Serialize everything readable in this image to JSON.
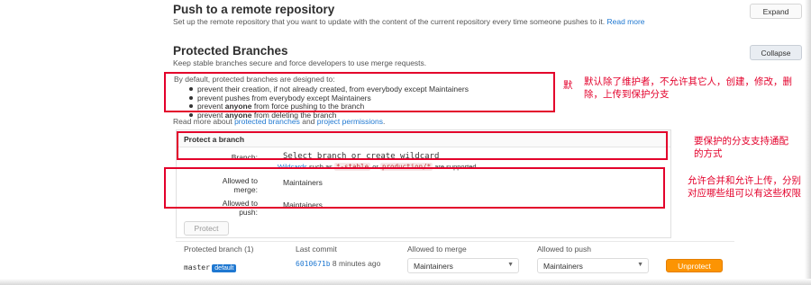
{
  "push_section": {
    "title": "Push to a remote repository",
    "description": "Set up the remote repository that you want to update with the content of the current repository every time someone pushes to it.",
    "read_more": "Read more",
    "expand_label": "Expand"
  },
  "protected_section": {
    "title": "Protected Branches",
    "description": "Keep stable branches secure and force developers to use merge requests.",
    "collapse_label": "Collapse",
    "defaults_heading": "By default, protected branches are designed to:",
    "bullets": [
      {
        "pre": "prevent their creation, if not already created, from everybody except Maintainers",
        "bold": "",
        "post": ""
      },
      {
        "pre": "prevent pushes from everybody except Maintainers",
        "bold": "",
        "post": ""
      },
      {
        "pre": "prevent ",
        "bold": "anyone",
        "post": " from force pushing to the branch"
      },
      {
        "pre": "prevent ",
        "bold": "anyone",
        "post": " from deleting the branch"
      }
    ],
    "read_more_prefix": "Read more about",
    "link_protected": "protected branches",
    "and": "and",
    "link_permissions": "project permissions",
    "period": "."
  },
  "protect_form": {
    "heading": "Protect a branch",
    "branch_label": "Branch:",
    "branch_placeholder": "Select branch or create wildcard",
    "wildcards_link": "Wildcards",
    "such_as": "such as",
    "example1": "*-stable",
    "or": "or",
    "example2": "production/*",
    "supported": "are supported",
    "merge_label": "Allowed to merge:",
    "merge_value": "Maintainers",
    "push_label": "Allowed to push:",
    "push_value": "Maintainers",
    "protect_button": "Protect"
  },
  "table": {
    "headers": [
      "Protected branch (1)",
      "Last commit",
      "Allowed to merge",
      "Allowed to push"
    ],
    "row": {
      "branch": "master",
      "badge": "default",
      "commit_sha": "6010671b",
      "commit_time": "8 minutes ago",
      "merge": "Maintainers",
      "push": "Maintainers",
      "unprotect_label": "Unprotect"
    }
  },
  "annotations": {
    "note_default_marker": "默",
    "note_default": "默认除了维护者，不允许其它人，创建，修改，删除，上传到保护分支",
    "note_wildcard": "要保护的分支支持通配的方式",
    "note_permissions": "允许合并和允许上传，分别对应哪些组可以有这些权限"
  },
  "colors": {
    "annotation_red": "#e3002b",
    "link_blue": "#1f78d1",
    "unprotect_orange": "#fc9403"
  }
}
